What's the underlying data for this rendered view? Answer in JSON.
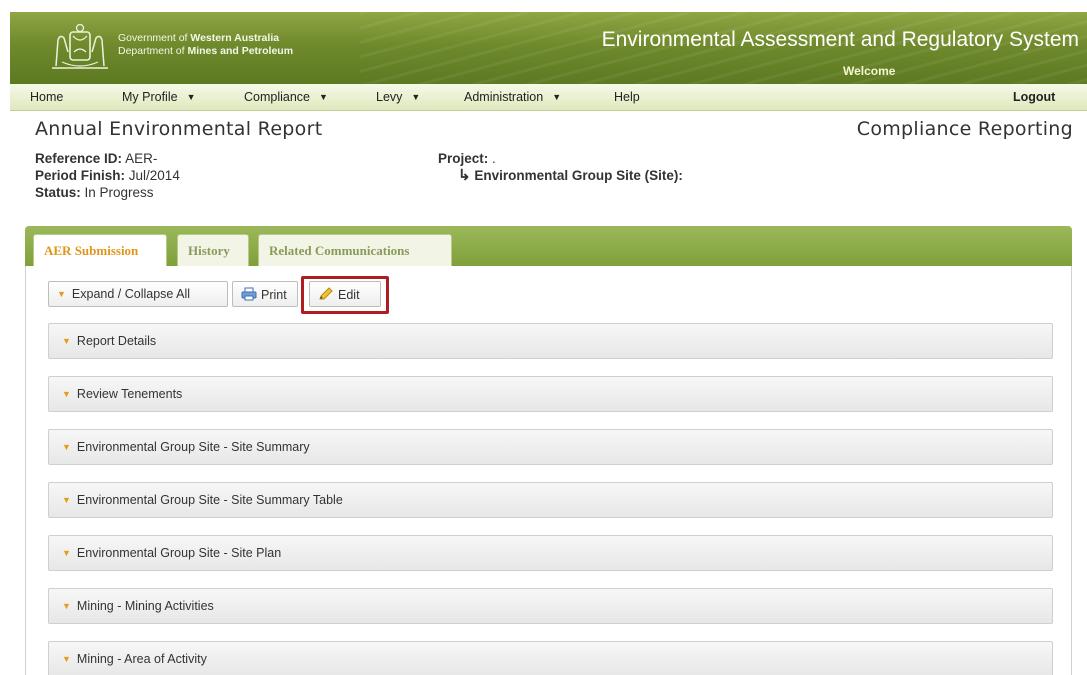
{
  "header": {
    "gov_prefix_1": "Government of ",
    "gov_bold_1": "Western Australia",
    "gov_prefix_2": "Department of ",
    "gov_bold_2": "Mines and Petroleum",
    "system_title": "Environmental Assessment and Regulatory System",
    "welcome": "Welcome"
  },
  "nav": {
    "home": "Home",
    "my_profile": "My Profile",
    "compliance": "Compliance",
    "levy": "Levy",
    "administration": "Administration",
    "help": "Help",
    "logout": "Logout"
  },
  "page": {
    "title": "Annual Environmental Report",
    "section": "Compliance Reporting"
  },
  "meta": {
    "reference_label": "Reference ID:",
    "reference_value": "AER-",
    "period_label": "Period Finish:",
    "period_value": "Jul/2014",
    "status_label": "Status:",
    "status_value": "In Progress",
    "project_label": "Project:",
    "project_value": ".",
    "site_label": "Environmental Group Site (Site):"
  },
  "tabs": [
    {
      "label": "AER Submission"
    },
    {
      "label": "History"
    },
    {
      "label": "Related Communications"
    }
  ],
  "toolbar": {
    "expand_collapse": "Expand / Collapse All",
    "print": "Print",
    "edit": "Edit"
  },
  "sections": [
    {
      "label": "Report Details"
    },
    {
      "label": "Review Tenements"
    },
    {
      "label": "Environmental Group Site - Site Summary"
    },
    {
      "label": "Environmental Group Site - Site Summary Table"
    },
    {
      "label": "Environmental Group Site - Site Plan"
    },
    {
      "label": "Mining - Mining Activities"
    },
    {
      "label": "Mining - Area of Activity"
    }
  ],
  "colors": {
    "banner_green": "#6f8a2c",
    "tab_active_text": "#e0961a",
    "highlight_red": "#b01c24"
  },
  "icons": [
    "crest-logo",
    "caret-down-icon",
    "printer-icon",
    "pencil-icon",
    "return-arrow-icon"
  ]
}
